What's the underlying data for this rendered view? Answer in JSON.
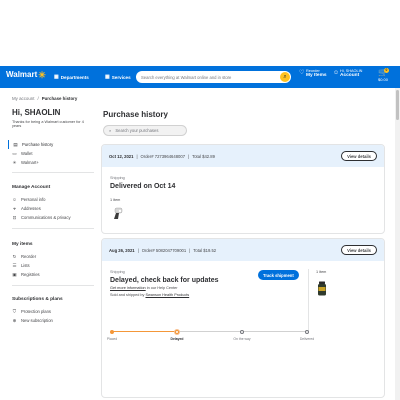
{
  "header": {
    "logo_text": "Walmart",
    "departments_label": "Departments",
    "services_label": "Services",
    "search_placeholder": "Search everything at Walmart online and in store",
    "reorder_top": "Reorder",
    "reorder_bottom": "My Items",
    "account_top": "Hi, SHAOLIN",
    "account_bottom": "Account",
    "cart_count": "0",
    "cart_total": "$0.00",
    "brand_color": "#0071dc",
    "accent_color": "#ffc220"
  },
  "breadcrumb": {
    "parent": "My account",
    "separator": "/",
    "current": "Purchase history"
  },
  "sidebar": {
    "greeting": "Hi, SHAOLIN",
    "thanks": "Thanks for being a Walmart customer for 4 years",
    "items_main": [
      {
        "label": "Purchase history",
        "icon": "receipt-icon"
      },
      {
        "label": "Walmart+",
        "icon": "spark-icon"
      }
    ],
    "wallet_label": "Wallet",
    "account_heading": "Manage Account",
    "account_items": [
      {
        "label": "Personal info",
        "icon": "person-icon"
      },
      {
        "label": "Addresses",
        "icon": "location-icon"
      },
      {
        "label": "Communications & privacy",
        "icon": "lock-icon"
      }
    ],
    "myitems_heading": "My items",
    "myitems_items": [
      {
        "label": "Reorder",
        "icon": "reorder-icon"
      },
      {
        "label": "Lists",
        "icon": "list-icon"
      },
      {
        "label": "Registries",
        "icon": "gift-icon"
      }
    ],
    "subs_heading": "Subscriptions & plans",
    "subs_items": [
      {
        "label": "Protection plans",
        "icon": "shield-icon"
      },
      {
        "label": "New subscription",
        "icon": "plus-icon"
      }
    ]
  },
  "main": {
    "title": "Purchase history",
    "search_placeholder": "Search your purchases",
    "orders": [
      {
        "date": "Oct 12, 2021",
        "order_number": "Order# 7273964648007",
        "total": "Total $42.89",
        "view_label": "View details",
        "shipping_label": "Shipping",
        "status": "Delivered on Oct 14",
        "items_count": "1 item"
      },
      {
        "date": "Aug 26, 2021",
        "order_number": "Order# 5082047709001",
        "total": "Total $19.52",
        "view_label": "View details",
        "shipping_label": "Shipping",
        "status": "Delayed, check back for updates",
        "info_prefix": "Get more information",
        "info_suffix": "in our Help Center",
        "sold_by_prefix": "Sold and shipped by",
        "seller": "Swanson Health Products",
        "track_label": "Track shipment",
        "items_count": "1 item",
        "progress_steps": [
          "Placed",
          "Delayed",
          "On the way",
          "Delivered"
        ],
        "progress_current": 1
      }
    ]
  }
}
